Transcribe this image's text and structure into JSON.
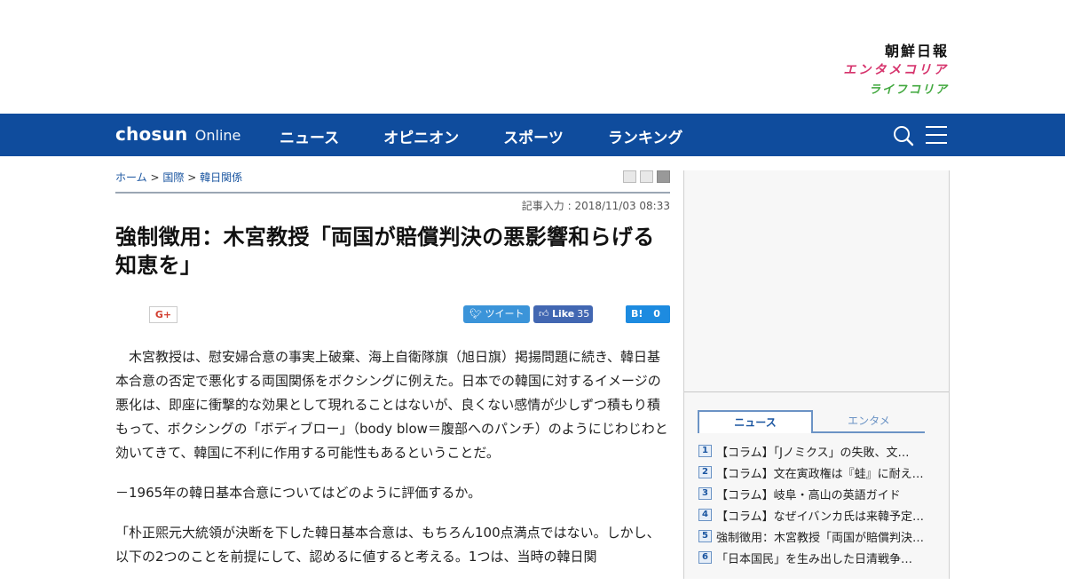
{
  "brand": {
    "main": "朝鮮日報",
    "ent": "エンタメコリア",
    "life": "ライフコリア"
  },
  "nav": {
    "logo_bold": "chosun",
    "logo_light": "Online",
    "items": [
      "ニュース",
      "オピニオン",
      "スポーツ",
      "ランキング"
    ],
    "search_icon": "search-icon",
    "menu_icon": "hamburger-menu-icon"
  },
  "breadcrumb": {
    "home": "ホーム",
    "sep": ">",
    "cat1": "国際",
    "cat2": "韓日関係"
  },
  "article": {
    "dateline": "記事入力 : 2018/11/03 08:33",
    "headline": "強制徴用：木宮教授「両国が賠償判決の悪影響和らげる知恵を」",
    "share": {
      "gplus": "G+",
      "tweet": "ツイート",
      "fb_like": "Like",
      "fb_count": "35",
      "hatena": "B!",
      "hatena_count": "0"
    },
    "paragraphs": [
      "　木宮教授は、慰安婦合意の事実上破棄、海上自衛隊旗（旭日旗）掲揚問題に続き、韓日基本合意の否定で悪化する両国関係をボクシングに例えた。日本での韓国に対するイメージの悪化は、即座に衝撃的な効果として現れることはないが、良くない感情が少しずつ積もり積もって、ボクシングの「ボディブロー」（body blow＝腹部へのパンチ）のようにじわじわと効いてきて、韓国に不利に作用する可能性もあるということだ。",
      "－1965年の韓日基本合意についてはどのように評価するか。",
      "「朴正煕元大統領が決断を下した韓日基本合意は、もちろん100点満点ではない。しかし、以下の2つのことを前提にして、認めるに値すると考える。1つは、当時の韓日関"
    ]
  },
  "sidebar": {
    "tab_news": "ニュース",
    "tab_ent": "エンタメ",
    "ranking": [
      {
        "num": "1",
        "text": "【コラム】「Jノミクス」の失敗、文…"
      },
      {
        "num": "2",
        "text": "【コラム】文在寅政権は『蛙』に耐え…"
      },
      {
        "num": "3",
        "text": "【コラム】岐阜・高山の英語ガイド"
      },
      {
        "num": "4",
        "text": "【コラム】なぜイバンカ氏は来韓予定…"
      },
      {
        "num": "5",
        "text": "強制徴用：木宮教授「両国が賠償判決…"
      },
      {
        "num": "6",
        "text": "「日本国民」を生み出した日清戦争…"
      }
    ]
  }
}
